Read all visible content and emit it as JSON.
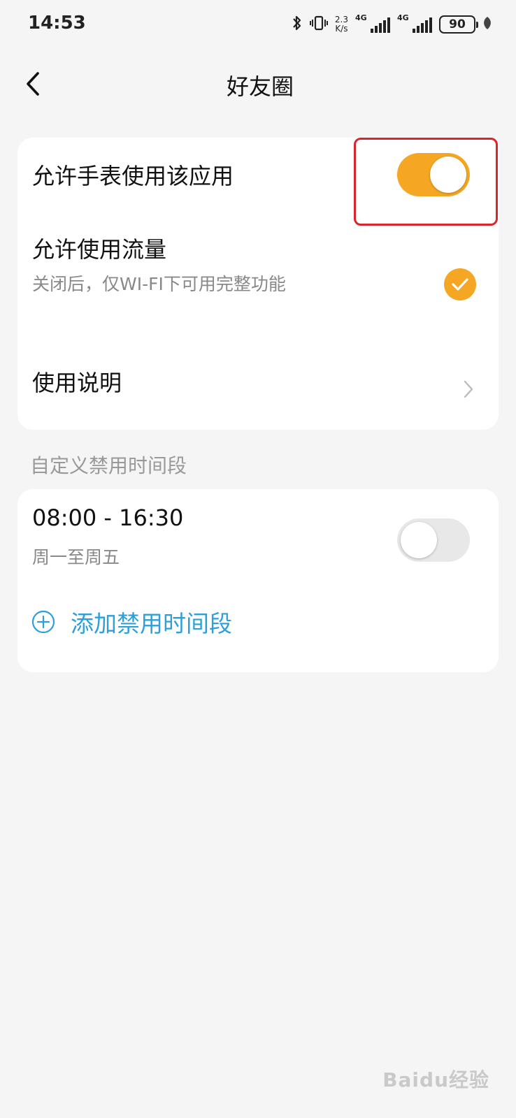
{
  "status_bar": {
    "time": "14:53",
    "speed_value": "2.3",
    "speed_unit": "K/s",
    "network1": "4G",
    "network2": "4G",
    "battery": "90"
  },
  "nav": {
    "title": "好友圈"
  },
  "settings": {
    "allow_watch": {
      "label": "允许手表使用该应用",
      "enabled": true
    },
    "allow_data": {
      "label": "允许使用流量",
      "description": "关闭后，仅WI-FI下可用完整功能",
      "checked": true
    },
    "instructions": {
      "label": "使用说明"
    }
  },
  "disable_periods": {
    "section_label": "自定义禁用时间段",
    "items": [
      {
        "time_range": "08:00 - 16:30",
        "days": "周一至周五",
        "enabled": false
      }
    ],
    "add_label": "添加禁用时间段"
  },
  "watermark": "Baidu经验",
  "colors": {
    "accent": "#f5a623",
    "link": "#2e9fd9",
    "highlight": "#d9262c",
    "background": "#f5f5f5"
  }
}
